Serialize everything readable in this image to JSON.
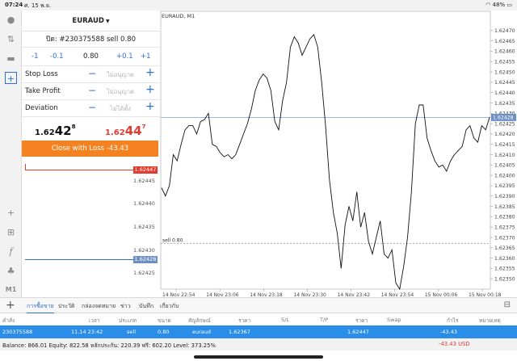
{
  "status_bar": {
    "time": "07:24",
    "date": "ศ. 15 พ.ย.",
    "battery": "48%"
  },
  "left_toolbar": {
    "icons": [
      "account-icon",
      "trade-icon",
      "chat-icon",
      "new-order-icon",
      "crosshair-icon",
      "indicators-icon",
      "function-icon",
      "objects-icon"
    ],
    "timeframe": "M1"
  },
  "order_panel": {
    "symbol": "EURAUD",
    "ticket_line": "ปิด: #230375588 sell 0.80",
    "volume": {
      "minus1": "-1",
      "minus01": "-0.1",
      "value": "0.80",
      "plus01": "+0.1",
      "plus1": "+1"
    },
    "params": [
      {
        "label": "Stop Loss",
        "value": "ไม่อนุญาต"
      },
      {
        "label": "Take Profit",
        "value": "ไม่อนุญาต"
      },
      {
        "label": "Deviation",
        "value": "ไม่ได้ตั้ง"
      }
    ],
    "bid": {
      "pre": "1.62",
      "big": "42",
      "sup": "8"
    },
    "ask": {
      "pre": "1.62",
      "big": "44",
      "sup": "7"
    },
    "close_button": "Close with Loss -43.43"
  },
  "mini_chart": {
    "axis_labels": [
      "1.62445",
      "1.62440",
      "1.62435",
      "1.62430",
      "1.62425"
    ],
    "ask_tag": "1.62447",
    "bid_tag": "1.62428"
  },
  "chart": {
    "title": "EURAUD, M1",
    "order_label": "sell 0.80",
    "current_price_tag": "1.62428",
    "colors": {
      "price_line": "#111111",
      "bid_line": "#7ea4d9",
      "ask_line": "#e23b30",
      "tag_bg": "#6e8fc4"
    }
  },
  "chart_data": {
    "type": "line",
    "x_ticks": [
      "14 Nov 22:54",
      "14 Nov 23:06",
      "14 Nov 23:18",
      "14 Nov 23:30",
      "14 Nov 23:42",
      "14 Nov 23:54",
      "15 Nov 00:06",
      "15 Nov 00:18"
    ],
    "y_ticks": [
      1.6247,
      1.62465,
      1.6246,
      1.62455,
      1.6245,
      1.62445,
      1.6244,
      1.62435,
      1.6243,
      1.62425,
      1.6242,
      1.62415,
      1.6241,
      1.62405,
      1.624,
      1.62395,
      1.6239,
      1.62385,
      1.6238,
      1.62375,
      1.6237,
      1.62365,
      1.6236,
      1.62355,
      1.6235
    ],
    "ylim": [
      1.62345,
      1.62475
    ],
    "order_price": 1.62367,
    "current_bid": 1.62428,
    "values": [
      1.62394,
      1.6239,
      1.62395,
      1.6241,
      1.62407,
      1.62415,
      1.62422,
      1.62424,
      1.62424,
      1.6242,
      1.62426,
      1.62427,
      1.6243,
      1.62415,
      1.62414,
      1.62411,
      1.62409,
      1.6241,
      1.62408,
      1.6241,
      1.62415,
      1.6242,
      1.62425,
      1.62432,
      1.62441,
      1.62446,
      1.62449,
      1.62447,
      1.62441,
      1.62426,
      1.62422,
      1.62436,
      1.62445,
      1.62462,
      1.62467,
      1.62464,
      1.62458,
      1.62462,
      1.62466,
      1.62468,
      1.62462,
      1.62445,
      1.62424,
      1.62398,
      1.62382,
      1.62372,
      1.62355,
      1.62376,
      1.62385,
      1.62378,
      1.62392,
      1.62375,
      1.62382,
      1.62368,
      1.62362,
      1.6237,
      1.62378,
      1.62362,
      1.6236,
      1.62364,
      1.62348,
      1.62345,
      1.62356,
      1.6237,
      1.62392,
      1.62425,
      1.62434,
      1.62434,
      1.62418,
      1.62412,
      1.62407,
      1.62404,
      1.62405,
      1.62402,
      1.62407,
      1.6241,
      1.62412,
      1.62414,
      1.62422,
      1.62424,
      1.62418,
      1.62416,
      1.62424,
      1.62422,
      1.62428
    ]
  },
  "tabs": [
    "การซื้อขาย",
    "ประวัติ",
    "กล่องจดหมาย",
    "ข่าว",
    "บันทึก",
    "เกี่ยวกับ"
  ],
  "table": {
    "headers": [
      "คำสั่ง",
      "เวลา",
      "ประเภท",
      "ขนาด",
      "สัญลักษณ์",
      "ราคา",
      "S/L",
      "T/P",
      "ราคา",
      "Swap",
      "กำไร",
      "หมายเหตุ"
    ],
    "row": [
      "230375588",
      "11.14 23:42",
      "sell",
      "0.80",
      "euraud",
      "1.62367",
      "",
      "",
      "1.62447",
      "",
      "-43.43",
      ""
    ]
  },
  "balance": {
    "text": "Balance: 866.01  Equity: 822.58  หลักประกัน: 220.39  ฟรี: 602.20  Level: 373.25%",
    "profit": "-43.43  USD"
  }
}
